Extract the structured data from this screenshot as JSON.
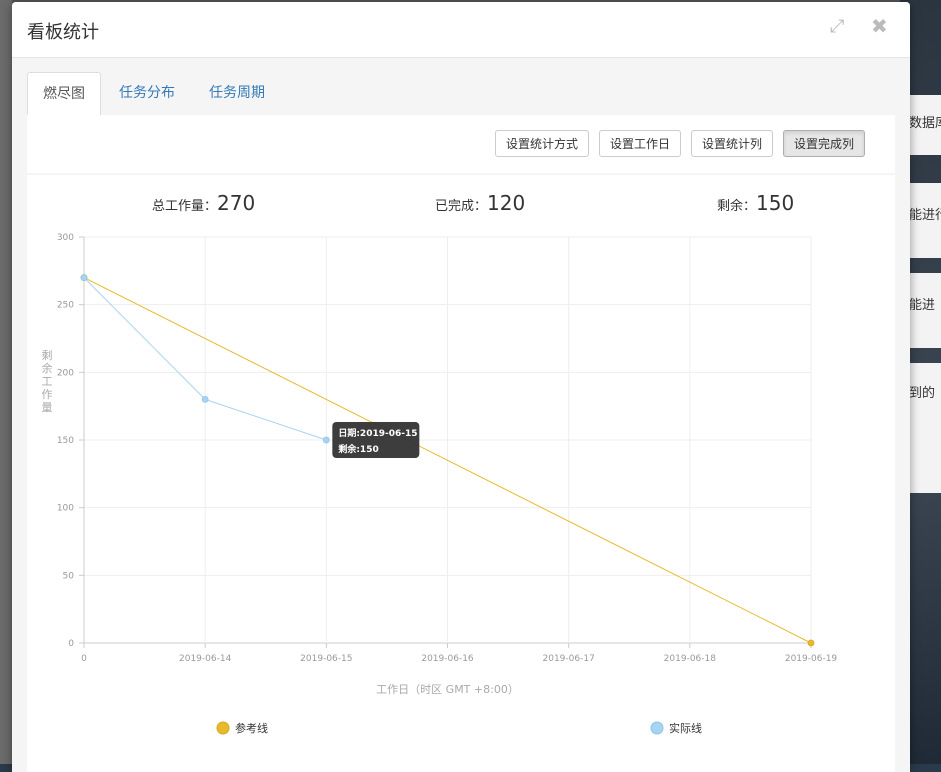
{
  "background": {
    "right_cards": [
      "数据库",
      "能进行",
      "能进",
      "到的"
    ]
  },
  "modal": {
    "title": "看板统计",
    "header_icons": {
      "expand": "expand-icon",
      "close": "close-icon"
    },
    "tabs": [
      {
        "label": "燃尽图",
        "active": true
      },
      {
        "label": "任务分布",
        "active": false
      },
      {
        "label": "任务周期",
        "active": false
      }
    ],
    "toolbar": {
      "stat_mode": "设置统计方式",
      "workdays": "设置工作日",
      "stat_columns": "设置统计列",
      "done_columns": "设置完成列"
    },
    "stats": {
      "total_label": "总工作量：",
      "total_value": "270",
      "done_label": "已完成：",
      "done_value": "120",
      "remaining_label": "剩余：",
      "remaining_value": "150"
    }
  },
  "chart_data": {
    "type": "line",
    "x": [
      "0",
      "2019-06-14",
      "2019-06-15",
      "2019-06-16",
      "2019-06-17",
      "2019-06-18",
      "2019-06-19"
    ],
    "xlabel": "工作日（时区 GMT +8:00）",
    "ylabel": "剩余工作量",
    "ylim": [
      0,
      300
    ],
    "yticks": [
      0,
      50,
      100,
      150,
      200,
      250,
      300
    ],
    "grid": true,
    "legend_position": "bottom",
    "colors": {
      "reference": "#e8b92c",
      "actual": "#a6d4f2"
    },
    "series": [
      {
        "name": "参考线",
        "values": [
          270,
          null,
          null,
          null,
          null,
          null,
          0
        ]
      },
      {
        "name": "实际线",
        "values": [
          270,
          180,
          150,
          null,
          null,
          null,
          null
        ]
      }
    ],
    "tooltip": {
      "index": 2,
      "line1": "日期:2019-06-15",
      "line2": "剩余:150"
    }
  }
}
